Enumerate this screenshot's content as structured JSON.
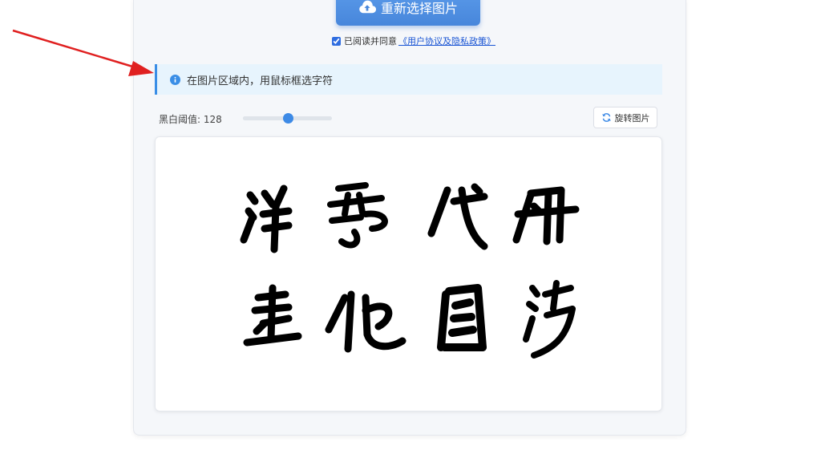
{
  "upload": {
    "label": "重新选择图片",
    "icon": "cloud-upload-icon"
  },
  "agreement": {
    "checked": true,
    "prefix": "已阅读并同意",
    "link": "《用户协议及隐私政策》"
  },
  "alert": {
    "icon": "info-icon",
    "text": "在图片区域内，用鼠标框选字符"
  },
  "threshold": {
    "label": "黑白阈值: 128",
    "value": 128,
    "min": 0,
    "max": 255
  },
  "rotate": {
    "label": "旋转图片",
    "icon": "rotate-icon"
  },
  "colors": {
    "primary": "#4786db",
    "alert_bg": "#e7f4fd",
    "alert_border": "#3a8ee6",
    "arrow": "#e02020"
  },
  "preview": {
    "image": "calligraphy-characters-image"
  }
}
